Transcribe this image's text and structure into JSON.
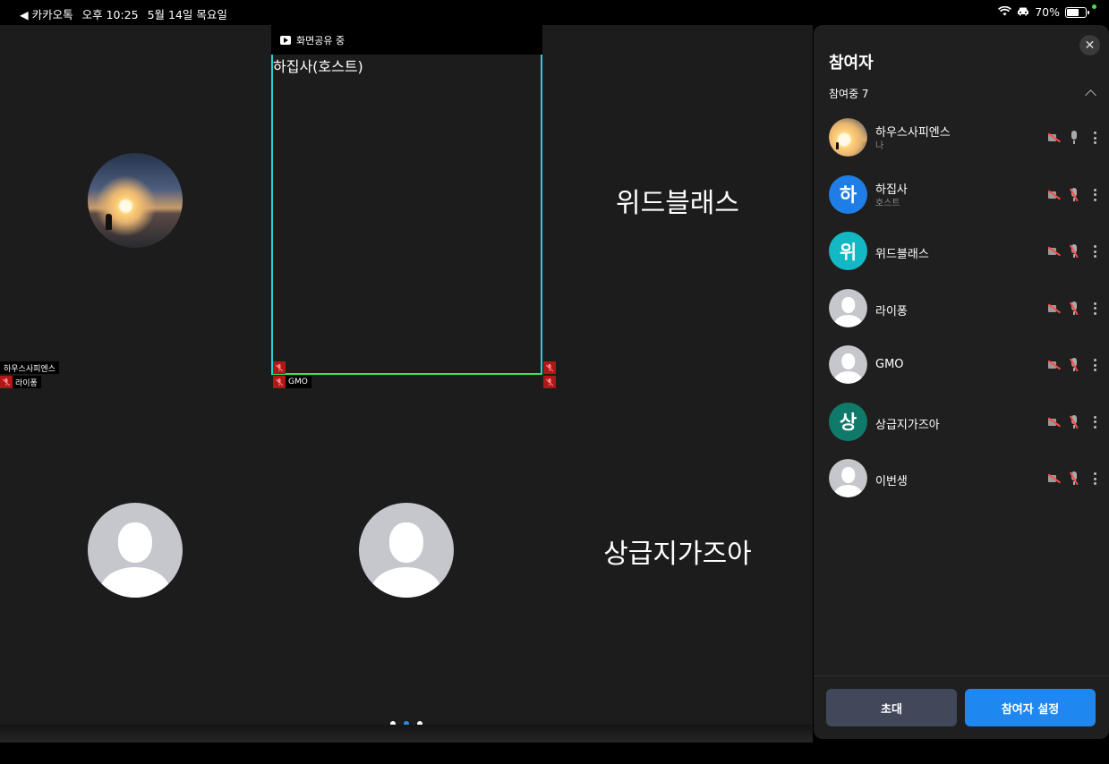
{
  "status": {
    "back_label": "◀ 카카오톡",
    "time": "오후 10:25",
    "date": "5월 14일 목요일",
    "battery": "70%",
    "battery_fill": 0.7
  },
  "grid": {
    "share_label": "화면공유 중",
    "tiles": [
      {
        "name": "",
        "avatar": "photo"
      },
      {
        "name": "하집사(호스트)",
        "avatar": "none"
      },
      {
        "name": "위드블래스",
        "avatar": "none"
      },
      {
        "name": "",
        "avatar": "default"
      },
      {
        "name": "",
        "avatar": "default"
      },
      {
        "name": "상급지가즈아",
        "avatar": "none"
      }
    ],
    "tags": {
      "self": "하우스사피엔스",
      "raipong": "라이퐁",
      "gmo": "GMO"
    },
    "pages": 3,
    "active_page": 1
  },
  "panel": {
    "title": "참여자",
    "group_label": "참여중 7",
    "participants": [
      {
        "name": "하우스사피엔스",
        "sub": "나",
        "avatar": "photo",
        "initial": "",
        "color": "",
        "mic_muted": false
      },
      {
        "name": "하집사",
        "sub": "호스트",
        "avatar": "initial",
        "initial": "하",
        "color": "#1e7ee6",
        "mic_muted": true
      },
      {
        "name": "위드블래스",
        "sub": "",
        "avatar": "initial",
        "initial": "위",
        "color": "#14b8c4",
        "mic_muted": true
      },
      {
        "name": "라이퐁",
        "sub": "",
        "avatar": "default",
        "initial": "",
        "color": "",
        "mic_muted": true
      },
      {
        "name": "GMO",
        "sub": "",
        "avatar": "default",
        "initial": "",
        "color": "",
        "mic_muted": true
      },
      {
        "name": "상급지가즈아",
        "sub": "",
        "avatar": "initial",
        "initial": "상",
        "color": "#0f7a6a",
        "mic_muted": true
      },
      {
        "name": "이번생",
        "sub": "",
        "avatar": "default",
        "initial": "",
        "color": "",
        "mic_muted": true
      }
    ],
    "invite_label": "초대",
    "settings_label": "참여자 설정",
    "close_icon": "close-icon"
  }
}
